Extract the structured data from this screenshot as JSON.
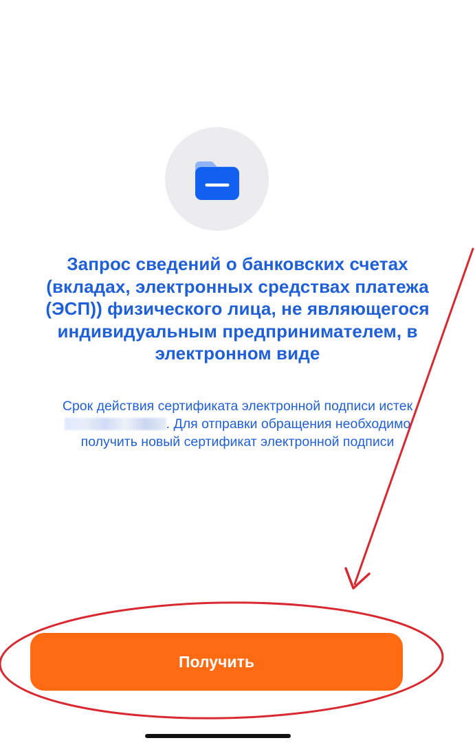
{
  "document": {
    "title": "Запрос сведений о банковских счетах (вкладах, электронных средствах платежа (ЭСП)) физического лица, не являющегося индивидуальным предпринимателем, в электронном виде",
    "message_part1": "Срок действия сертификата электронной подписи истек ",
    "message_part2": ". Для отправки обращения необходимо получить новый сертификат электронной подписи"
  },
  "actions": {
    "get_button_label": "Получить"
  },
  "icons": {
    "hero": "folder-icon"
  },
  "colors": {
    "accent_text": "#1f5fd8",
    "icon_blue": "#1260f0",
    "button_orange": "#ff6a13",
    "annotation_red": "#d9282f",
    "icon_bg": "#ececef"
  }
}
